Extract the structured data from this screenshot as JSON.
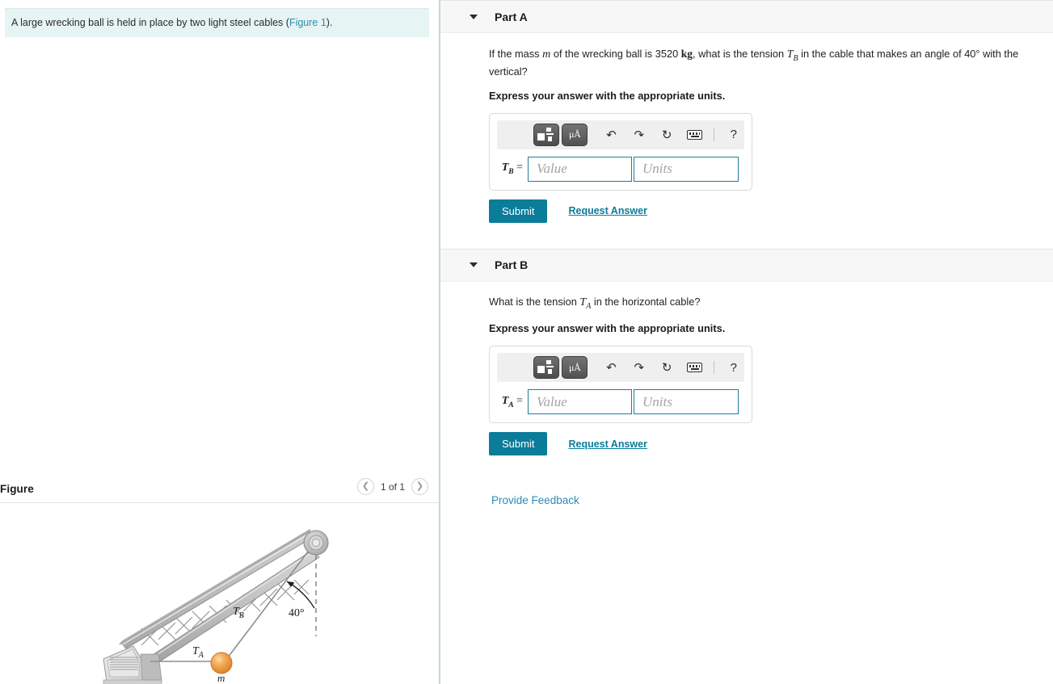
{
  "prompt": {
    "text_before": "A large wrecking ball is held in place by two light steel cables (",
    "link_label": "Figure 1",
    "text_after": ")."
  },
  "figure_panel": {
    "title": "Figure",
    "pager": {
      "prev_icon": "chevron-left-icon",
      "label": "1 of 1",
      "next_icon": "chevron-right-icon"
    },
    "diagram": {
      "type": "crane-wrecking-ball",
      "angle_label": "40°",
      "cable_b_label": "T",
      "cable_b_sub": "B",
      "cable_a_label": "T",
      "cable_a_sub": "A",
      "mass_label": "m"
    }
  },
  "parts": [
    {
      "caret_icon": "caret-down-icon",
      "label": "Part A",
      "question_segments": {
        "s1": "If the mass ",
        "var1": "m",
        "s2": " of the wrecking ball is 3520 ",
        "unit1": "kg",
        "s3": ", what is the tension ",
        "var2": "T",
        "var2_sub": "B",
        "s4": " in the cable that makes an angle of 40° with the vertical?"
      },
      "instruction": "Express your answer with the appropriate units.",
      "toolbar": {
        "template_icon": "math-template-icon",
        "units_icon": "micro-angstrom-units-icon",
        "units_icon_label": "μÅ",
        "undo_icon": "undo-arrow-icon",
        "undo_glyph": "↶",
        "redo_icon": "redo-arrow-icon",
        "redo_glyph": "↷",
        "reset_icon": "reset-circular-arrow-icon",
        "reset_glyph": "↻",
        "keyboard_icon": "keyboard-icon",
        "help_icon": "help-question-icon",
        "help_glyph": "?"
      },
      "field": {
        "label_var": "T",
        "label_sub": "B",
        "label_eq": "=",
        "value_placeholder": "Value",
        "units_placeholder": "Units",
        "value": "",
        "units": ""
      },
      "submit_label": "Submit",
      "request_answer_label": "Request Answer"
    },
    {
      "caret_icon": "caret-down-icon",
      "label": "Part B",
      "question_segments": {
        "s1": "What is the tension ",
        "var1": "",
        "s2": "",
        "unit1": "",
        "s3": "",
        "var2": "T",
        "var2_sub": "A",
        "s4": " in the horizontal cable?"
      },
      "instruction": "Express your answer with the appropriate units.",
      "toolbar": {
        "template_icon": "math-template-icon",
        "units_icon": "micro-angstrom-units-icon",
        "units_icon_label": "μÅ",
        "undo_icon": "undo-arrow-icon",
        "undo_glyph": "↶",
        "redo_icon": "redo-arrow-icon",
        "redo_glyph": "↷",
        "reset_icon": "reset-circular-arrow-icon",
        "reset_glyph": "↻",
        "keyboard_icon": "keyboard-icon",
        "help_icon": "help-question-icon",
        "help_glyph": "?"
      },
      "field": {
        "label_var": "T",
        "label_sub": "A",
        "label_eq": "=",
        "value_placeholder": "Value",
        "units_placeholder": "Units",
        "value": "",
        "units": ""
      },
      "submit_label": "Submit",
      "request_answer_label": "Request Answer"
    }
  ],
  "feedback_label": "Provide Feedback",
  "colors": {
    "accent_teal": "#0b7c99",
    "link_blue": "#2a8bb5",
    "banner_bg": "#e6f4f3",
    "part_header_bg": "#f7f7f7",
    "ball_orange": "#f0a14b"
  }
}
